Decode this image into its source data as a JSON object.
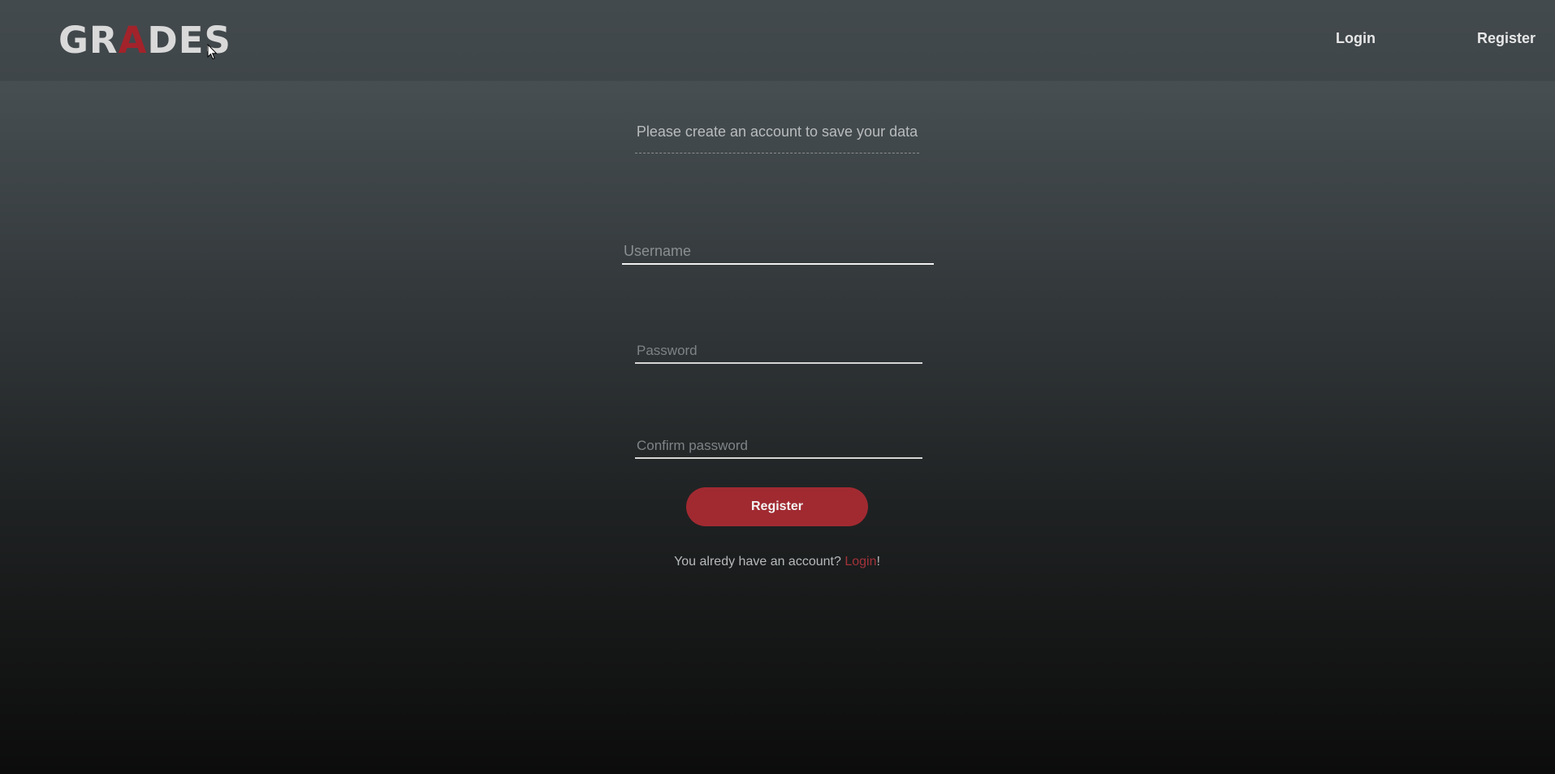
{
  "header": {
    "logo_prefix": "GR",
    "logo_accent": "A",
    "logo_suffix": "DES",
    "nav": {
      "login_label": "Login",
      "register_label": "Register"
    }
  },
  "form": {
    "subtitle": "Please create an account to save your data",
    "username": {
      "value": "",
      "placeholder": "Username"
    },
    "password": {
      "value": "",
      "placeholder": "Password"
    },
    "confirm_password": {
      "value": "",
      "placeholder": "Confirm password"
    },
    "submit_label": "Register",
    "login_prompt": {
      "text_before": "You alredy have an account? ",
      "link_label": "Login",
      "text_after": "!"
    }
  },
  "colors": {
    "accent": "#a12a31",
    "navbar": "#434a4e",
    "text": "#e7e7e7"
  },
  "icons": {
    "pointer": "mouse-pointer-icon"
  }
}
